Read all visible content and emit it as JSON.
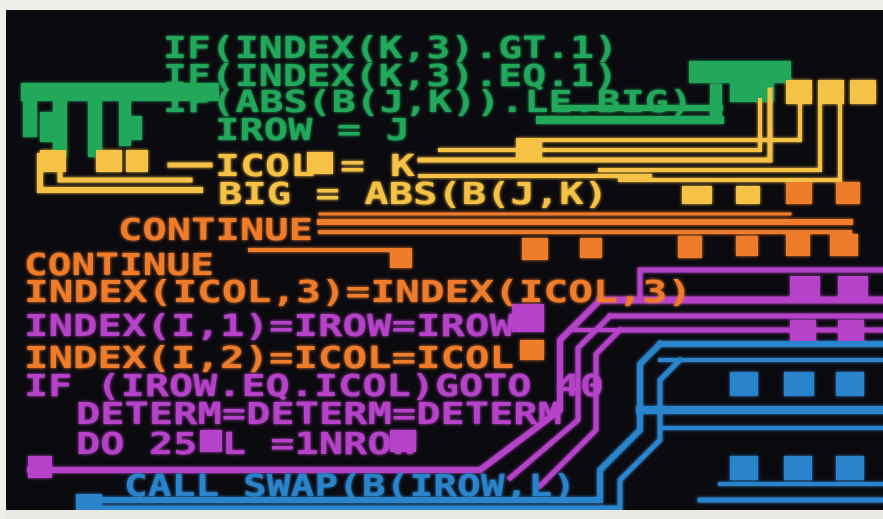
{
  "photo": {
    "code_lines": [
      {
        "text": "IF(INDEX(K,3).GT.1)",
        "color": "#23a85a"
      },
      {
        "text": "IF(INDEX(K,3).EQ.1)",
        "color": "#23a85a"
      },
      {
        "text": "IF(ABS(B(J,K)).LE.BIG)",
        "color": "#23a85a"
      },
      {
        "text": "IROW = J",
        "color": "#23a85a"
      },
      {
        "text": "ICOL = K",
        "color": "#f6c244"
      },
      {
        "text": "BIG = ABS(B(J,K)",
        "color": "#f6c244"
      },
      {
        "text": "CONTINUE",
        "color": "#ee7b2c"
      },
      {
        "text": "CONTINUE",
        "color": "#ee7b2c"
      },
      {
        "text": "INDEX(ICOL,3)=INDEX(ICOL,3)",
        "color": "#ee7b2c"
      },
      {
        "text": "INDEX(I,1)=IROW=IROW",
        "color": "#b542c8"
      },
      {
        "text": "INDEX(I,2)=ICOL=ICOL",
        "color": "#ee7b2c"
      },
      {
        "text": "IF (IROW.EQ.ICOL)GOTO 40",
        "color": "#b542c8"
      },
      {
        "text": "DETERM=DETERM=DETERM",
        "color": "#b542c8"
      },
      {
        "text": "DO 25 L =1NROW",
        "color": "#b542c8"
      },
      {
        "text": "CALL SWAP(B(IROW,L)",
        "color": "#2a84cc"
      }
    ],
    "palette": {
      "screen": "#0b0a0f",
      "green": "#23a85a",
      "yellow": "#f6c244",
      "orange": "#ee7b2c",
      "purple": "#b542c8",
      "blue": "#2a84cc"
    }
  }
}
